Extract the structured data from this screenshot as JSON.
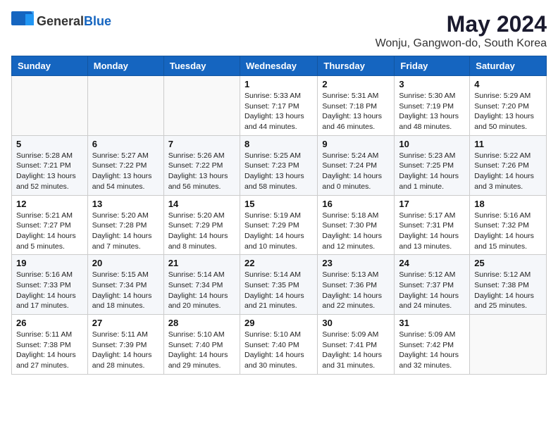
{
  "logo": {
    "text_general": "General",
    "text_blue": "Blue"
  },
  "title": "May 2024",
  "subtitle": "Wonju, Gangwon-do, South Korea",
  "days_of_week": [
    "Sunday",
    "Monday",
    "Tuesday",
    "Wednesday",
    "Thursday",
    "Friday",
    "Saturday"
  ],
  "weeks": [
    [
      {
        "day": "",
        "info": ""
      },
      {
        "day": "",
        "info": ""
      },
      {
        "day": "",
        "info": ""
      },
      {
        "day": "1",
        "info": "Sunrise: 5:33 AM\nSunset: 7:17 PM\nDaylight: 13 hours\nand 44 minutes."
      },
      {
        "day": "2",
        "info": "Sunrise: 5:31 AM\nSunset: 7:18 PM\nDaylight: 13 hours\nand 46 minutes."
      },
      {
        "day": "3",
        "info": "Sunrise: 5:30 AM\nSunset: 7:19 PM\nDaylight: 13 hours\nand 48 minutes."
      },
      {
        "day": "4",
        "info": "Sunrise: 5:29 AM\nSunset: 7:20 PM\nDaylight: 13 hours\nand 50 minutes."
      }
    ],
    [
      {
        "day": "5",
        "info": "Sunrise: 5:28 AM\nSunset: 7:21 PM\nDaylight: 13 hours\nand 52 minutes."
      },
      {
        "day": "6",
        "info": "Sunrise: 5:27 AM\nSunset: 7:22 PM\nDaylight: 13 hours\nand 54 minutes."
      },
      {
        "day": "7",
        "info": "Sunrise: 5:26 AM\nSunset: 7:22 PM\nDaylight: 13 hours\nand 56 minutes."
      },
      {
        "day": "8",
        "info": "Sunrise: 5:25 AM\nSunset: 7:23 PM\nDaylight: 13 hours\nand 58 minutes."
      },
      {
        "day": "9",
        "info": "Sunrise: 5:24 AM\nSunset: 7:24 PM\nDaylight: 14 hours\nand 0 minutes."
      },
      {
        "day": "10",
        "info": "Sunrise: 5:23 AM\nSunset: 7:25 PM\nDaylight: 14 hours\nand 1 minute."
      },
      {
        "day": "11",
        "info": "Sunrise: 5:22 AM\nSunset: 7:26 PM\nDaylight: 14 hours\nand 3 minutes."
      }
    ],
    [
      {
        "day": "12",
        "info": "Sunrise: 5:21 AM\nSunset: 7:27 PM\nDaylight: 14 hours\nand 5 minutes."
      },
      {
        "day": "13",
        "info": "Sunrise: 5:20 AM\nSunset: 7:28 PM\nDaylight: 14 hours\nand 7 minutes."
      },
      {
        "day": "14",
        "info": "Sunrise: 5:20 AM\nSunset: 7:29 PM\nDaylight: 14 hours\nand 8 minutes."
      },
      {
        "day": "15",
        "info": "Sunrise: 5:19 AM\nSunset: 7:29 PM\nDaylight: 14 hours\nand 10 minutes."
      },
      {
        "day": "16",
        "info": "Sunrise: 5:18 AM\nSunset: 7:30 PM\nDaylight: 14 hours\nand 12 minutes."
      },
      {
        "day": "17",
        "info": "Sunrise: 5:17 AM\nSunset: 7:31 PM\nDaylight: 14 hours\nand 13 minutes."
      },
      {
        "day": "18",
        "info": "Sunrise: 5:16 AM\nSunset: 7:32 PM\nDaylight: 14 hours\nand 15 minutes."
      }
    ],
    [
      {
        "day": "19",
        "info": "Sunrise: 5:16 AM\nSunset: 7:33 PM\nDaylight: 14 hours\nand 17 minutes."
      },
      {
        "day": "20",
        "info": "Sunrise: 5:15 AM\nSunset: 7:34 PM\nDaylight: 14 hours\nand 18 minutes."
      },
      {
        "day": "21",
        "info": "Sunrise: 5:14 AM\nSunset: 7:34 PM\nDaylight: 14 hours\nand 20 minutes."
      },
      {
        "day": "22",
        "info": "Sunrise: 5:14 AM\nSunset: 7:35 PM\nDaylight: 14 hours\nand 21 minutes."
      },
      {
        "day": "23",
        "info": "Sunrise: 5:13 AM\nSunset: 7:36 PM\nDaylight: 14 hours\nand 22 minutes."
      },
      {
        "day": "24",
        "info": "Sunrise: 5:12 AM\nSunset: 7:37 PM\nDaylight: 14 hours\nand 24 minutes."
      },
      {
        "day": "25",
        "info": "Sunrise: 5:12 AM\nSunset: 7:38 PM\nDaylight: 14 hours\nand 25 minutes."
      }
    ],
    [
      {
        "day": "26",
        "info": "Sunrise: 5:11 AM\nSunset: 7:38 PM\nDaylight: 14 hours\nand 27 minutes."
      },
      {
        "day": "27",
        "info": "Sunrise: 5:11 AM\nSunset: 7:39 PM\nDaylight: 14 hours\nand 28 minutes."
      },
      {
        "day": "28",
        "info": "Sunrise: 5:10 AM\nSunset: 7:40 PM\nDaylight: 14 hours\nand 29 minutes."
      },
      {
        "day": "29",
        "info": "Sunrise: 5:10 AM\nSunset: 7:40 PM\nDaylight: 14 hours\nand 30 minutes."
      },
      {
        "day": "30",
        "info": "Sunrise: 5:09 AM\nSunset: 7:41 PM\nDaylight: 14 hours\nand 31 minutes."
      },
      {
        "day": "31",
        "info": "Sunrise: 5:09 AM\nSunset: 7:42 PM\nDaylight: 14 hours\nand 32 minutes."
      },
      {
        "day": "",
        "info": ""
      }
    ]
  ]
}
